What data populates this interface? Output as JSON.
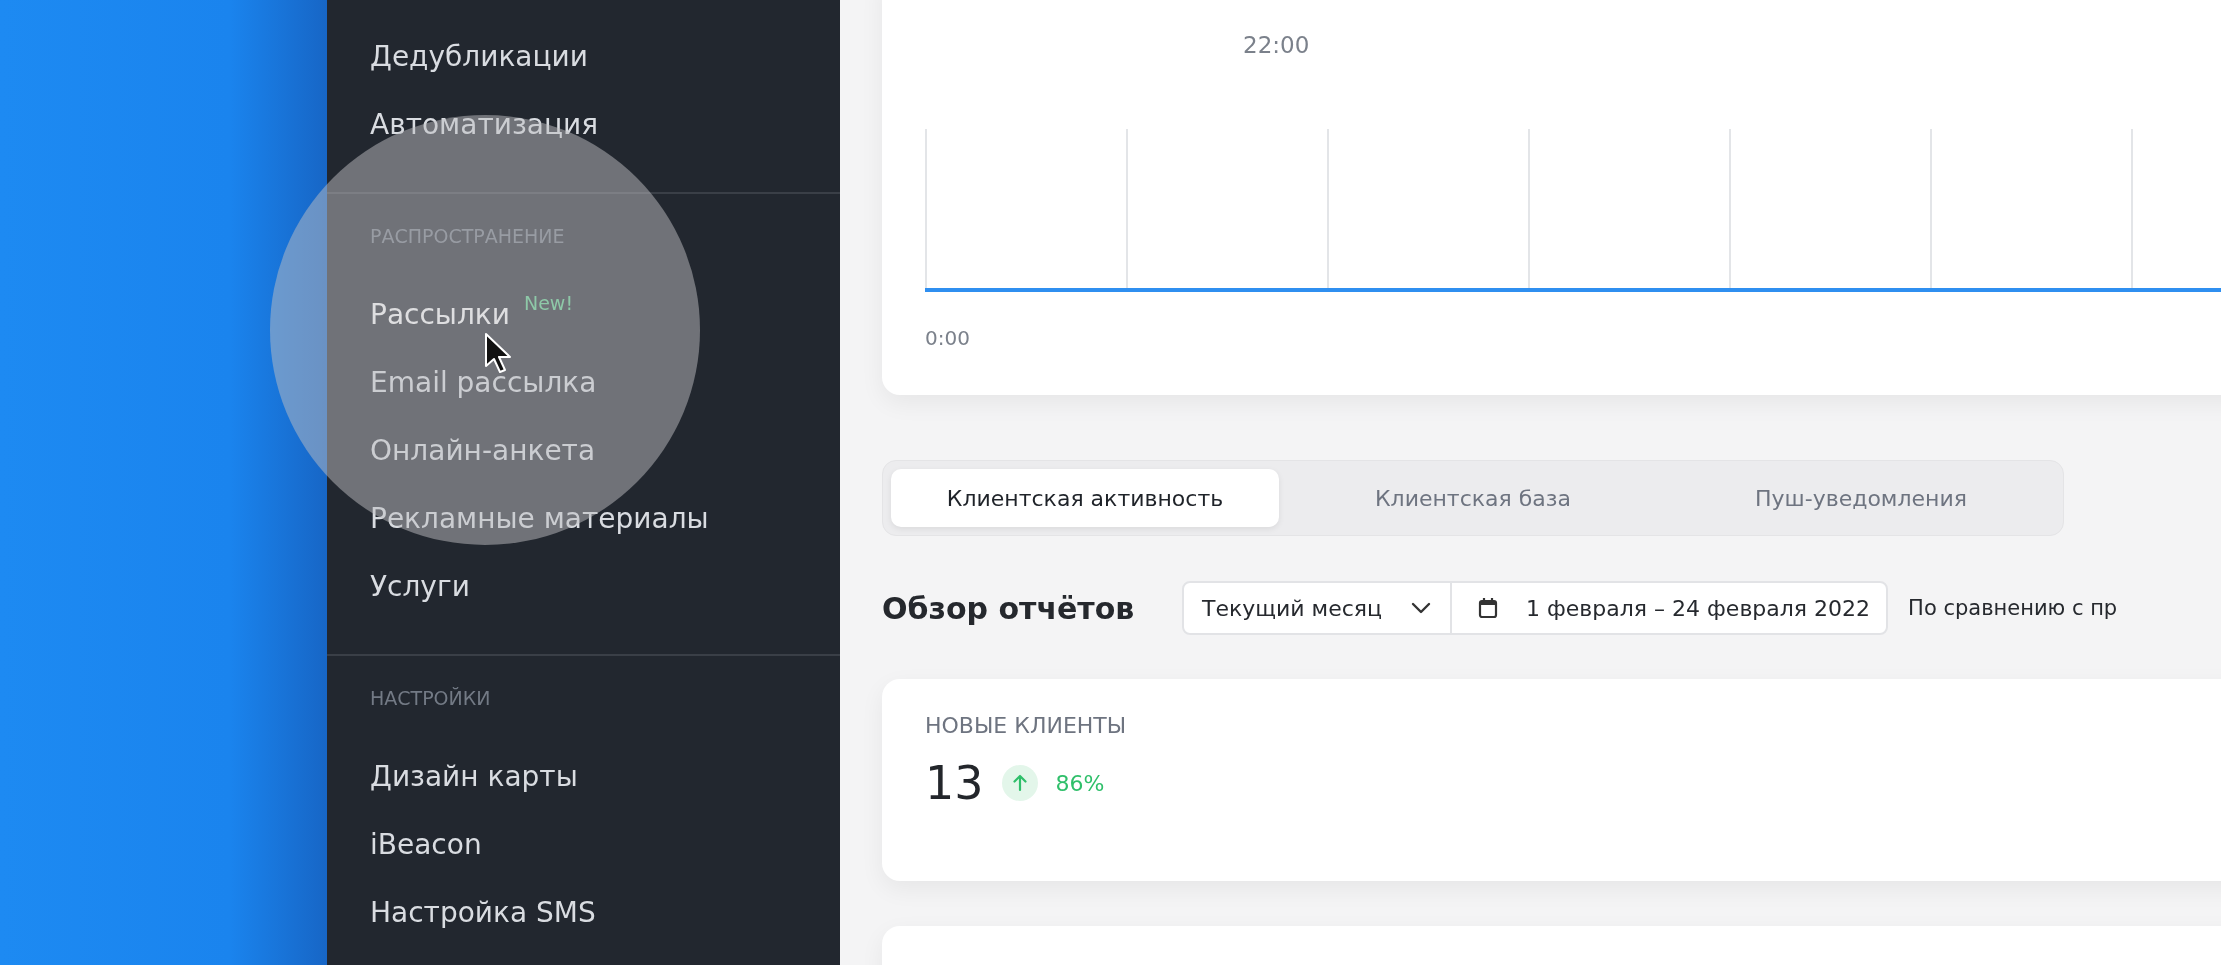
{
  "sidebar": {
    "sections": [
      {
        "items": [
          {
            "label": "Дедубликации",
            "selected": false
          },
          {
            "label": "Автоматизация",
            "selected": false
          }
        ]
      },
      {
        "header": "РАСПРОСТРАНЕНИЕ",
        "items": [
          {
            "label": "Рассылки",
            "badge": "New!",
            "selected": true
          },
          {
            "label": "Email рассылка",
            "selected": false
          },
          {
            "label": "Онлайн-анкета",
            "selected": false
          },
          {
            "label": "Рекламные материалы",
            "selected": false
          },
          {
            "label": "Услуги",
            "selected": false
          }
        ]
      },
      {
        "header": "НАСТРОЙКИ",
        "items": [
          {
            "label": "Дизайн карты",
            "selected": false
          },
          {
            "label": "iBeacon",
            "selected": false
          },
          {
            "label": "Настройка SMS",
            "selected": false
          }
        ]
      }
    ]
  },
  "activity_chart": {
    "peak_time": "22:00",
    "axis_start": "0:00"
  },
  "tabs": [
    {
      "label": "Клиентская активность",
      "selected": true
    },
    {
      "label": "Клиентская база",
      "selected": false
    },
    {
      "label": "Пуш-уведомления",
      "selected": false
    }
  ],
  "report": {
    "title": "Обзор отчётов",
    "period": "Текущий месяц",
    "date_range": "1 февраля – 24 февраля 2022",
    "comparison": "По сравнению с пр"
  },
  "stats": [
    {
      "label": "НОВЫЕ КЛИЕНТЫ",
      "value": "13",
      "kind": "up",
      "change": "86%"
    }
  ]
}
